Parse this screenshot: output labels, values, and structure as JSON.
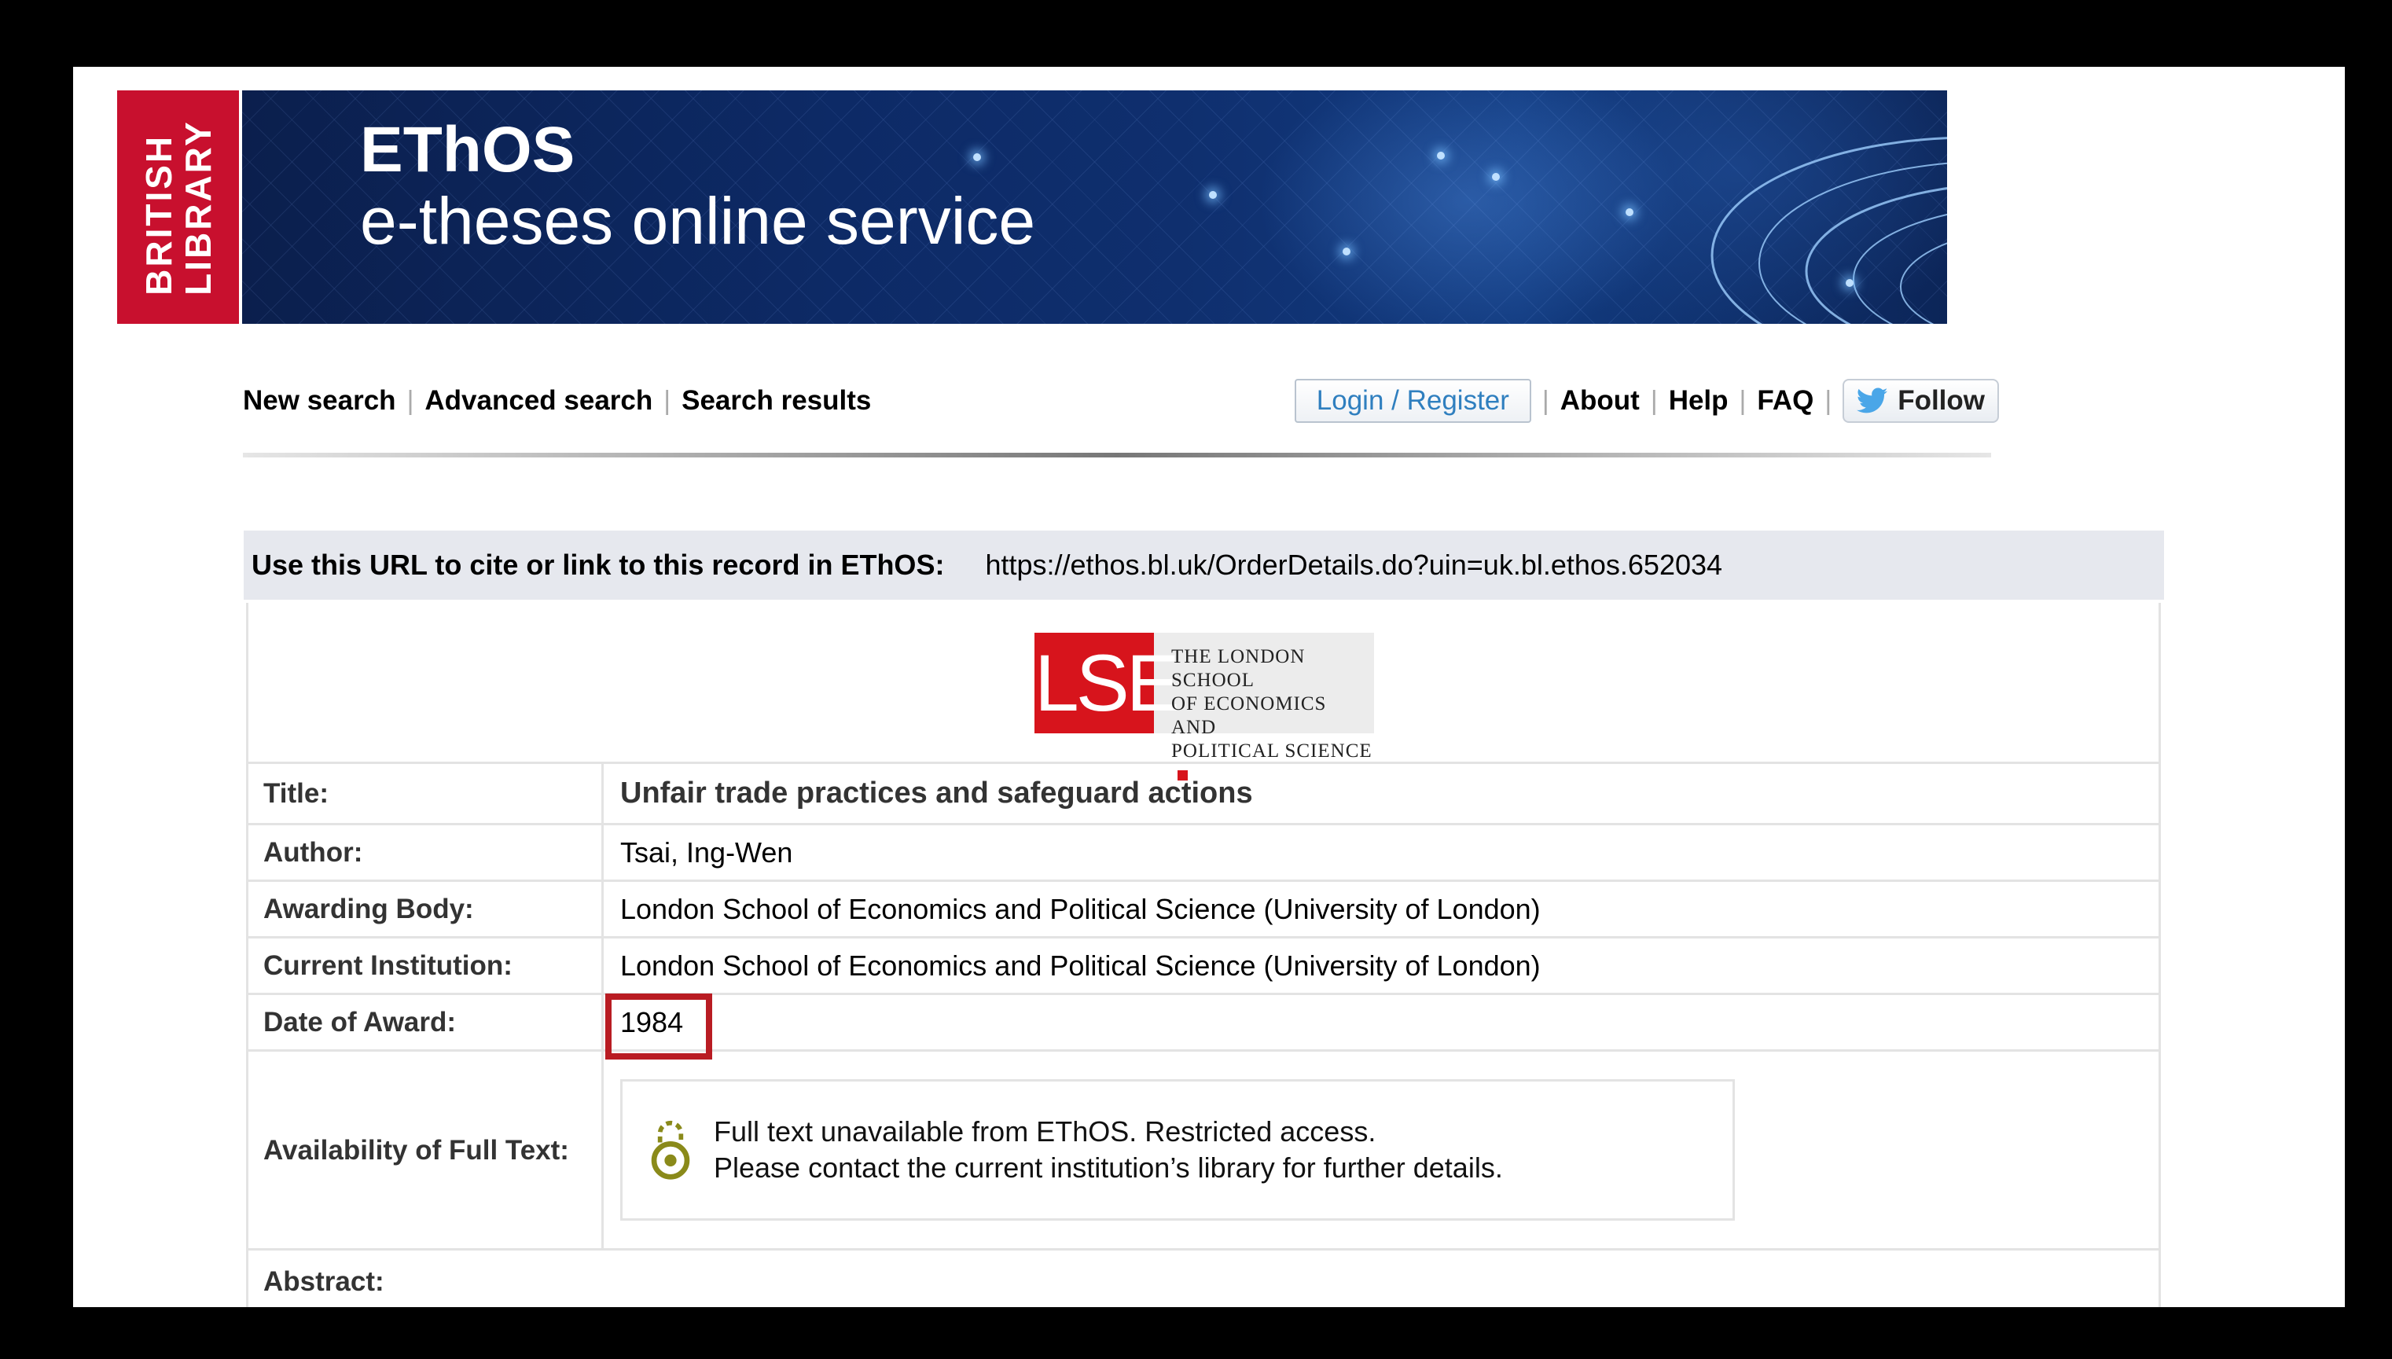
{
  "banner": {
    "bl_logo_line1": "BRITISH",
    "bl_logo_line2": "LIBRARY",
    "title": "EThOS",
    "subtitle": "e-theses online service"
  },
  "nav": {
    "left": [
      "New search",
      "Advanced search",
      "Search results"
    ],
    "login_label": "Login / Register",
    "right": [
      "About",
      "Help",
      "FAQ"
    ],
    "follow_label": "Follow"
  },
  "record": {
    "url_label": "Use this URL to cite or link to this record in EThOS:",
    "url_value": "https://ethos.bl.uk/OrderDetails.do?uin=uk.bl.ethos.652034",
    "institution_logo": {
      "mark": "LSE",
      "line1": "THE LONDON SCHOOL",
      "line2": "OF ECONOMICS AND",
      "line3": "POLITICAL SCIENCE",
      "color": "#d7141c"
    },
    "fields": {
      "title_label": "Title:",
      "title_value": "Unfair trade practices and safeguard actions",
      "author_label": "Author:",
      "author_value": "Tsai, Ing-Wen",
      "awarding_label": "Awarding Body:",
      "awarding_value": "London School of Economics and Political Science (University of London)",
      "institution_label": "Current Institution:",
      "institution_value": "London School of Economics and Political Science (University of London)",
      "date_label": "Date of Award:",
      "date_value": "1984",
      "availability_label": "Availability of Full Text:",
      "availability_line1": "Full text unavailable from EThOS. Restricted access.",
      "availability_line2": "Please contact the current institution’s library for further details.",
      "abstract_label": "Abstract:"
    }
  },
  "colors": {
    "highlight": "#b91c23",
    "link": "#2f7fbf",
    "bl_red": "#c8102e"
  }
}
